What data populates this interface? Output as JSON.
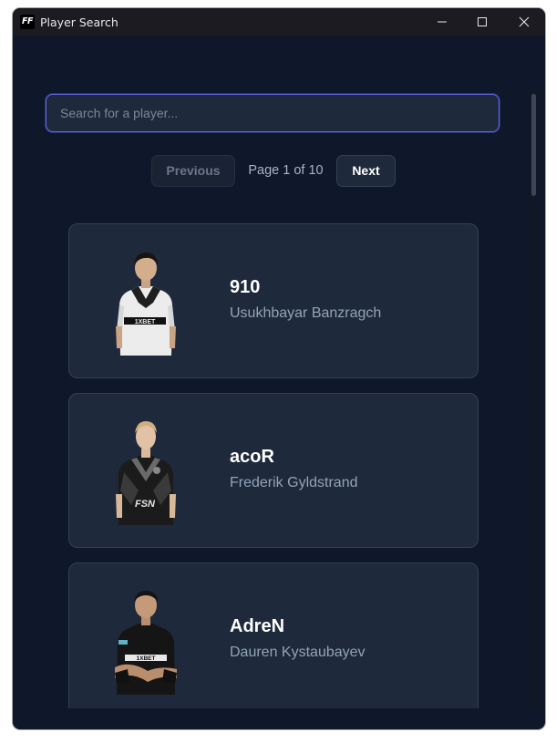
{
  "window": {
    "title": "Player Search",
    "logo_text": "FF"
  },
  "search": {
    "placeholder": "Search for a player...",
    "value": ""
  },
  "pagination": {
    "previous_label": "Previous",
    "page_info": "Page 1 of 10",
    "next_label": "Next"
  },
  "players": [
    {
      "nickname": "910",
      "full_name": "Usukhbayar Banzragch",
      "jersey": "white",
      "sponsor": "1XBET"
    },
    {
      "nickname": "acoR",
      "full_name": "Frederik Gyldstrand",
      "jersey": "black",
      "sponsor": "FSN"
    },
    {
      "nickname": "AdreN",
      "full_name": "Dauren Kystaubayev",
      "jersey": "black",
      "sponsor": "1XBET"
    }
  ],
  "colors": {
    "background": "#0f172a",
    "card": "#1e293b",
    "focus_ring": "#6366f1",
    "muted_text": "#94a3b8"
  }
}
